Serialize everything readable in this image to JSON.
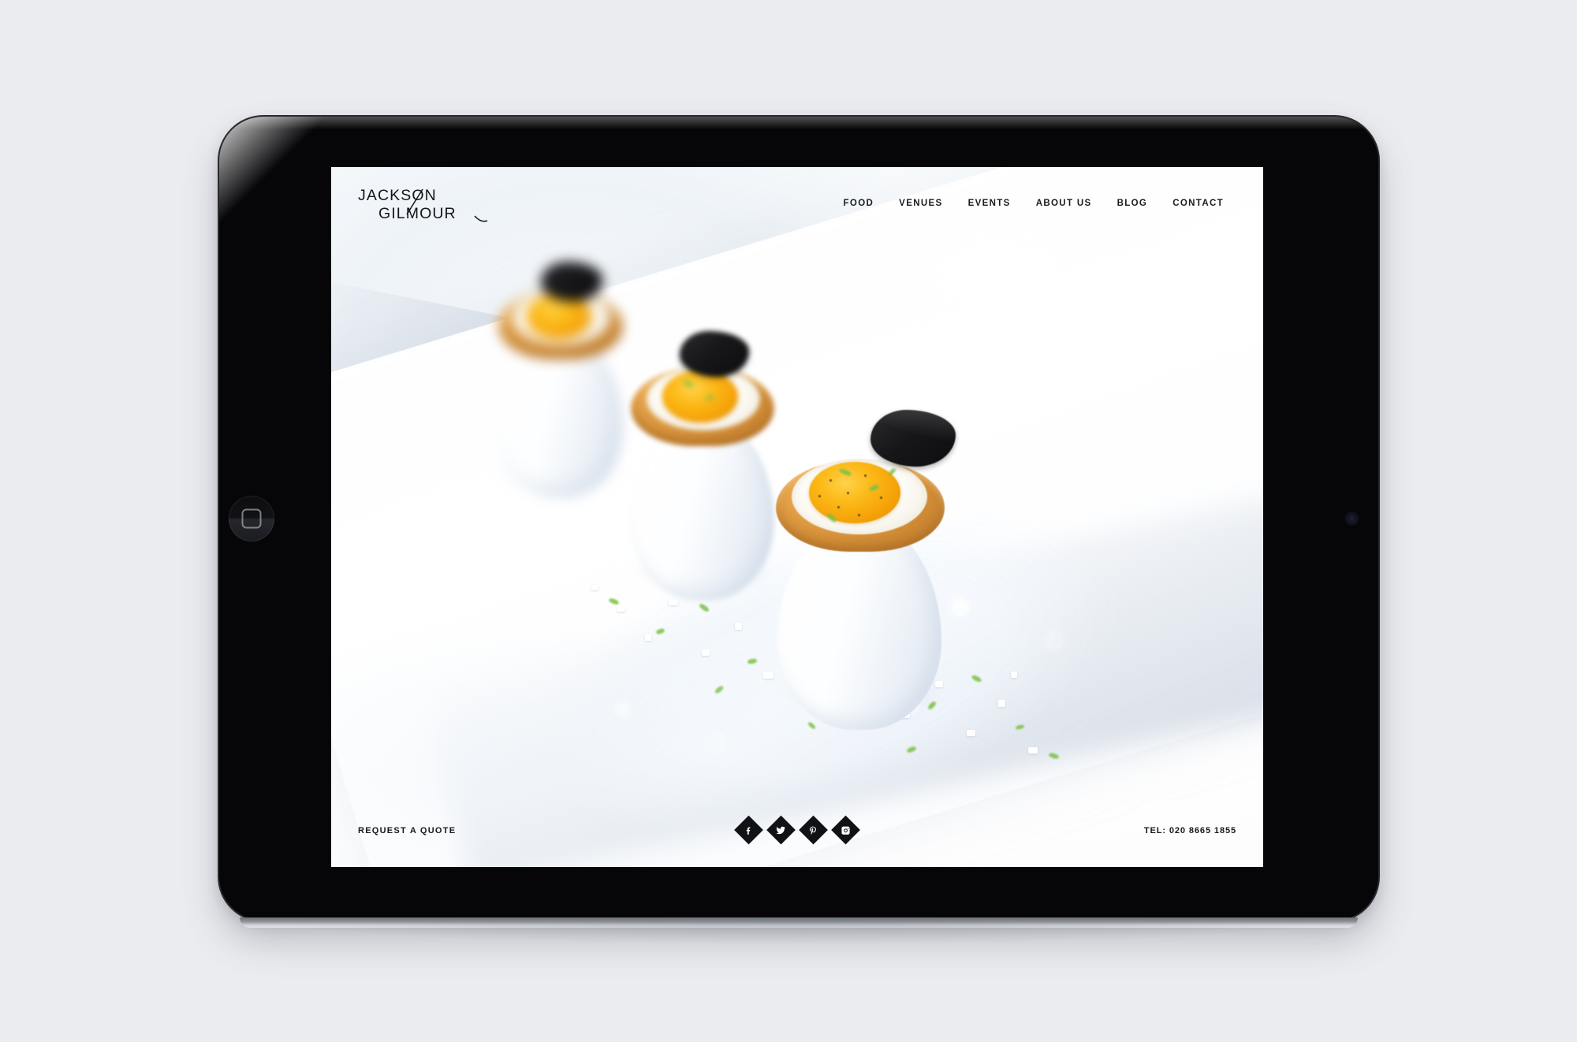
{
  "device": {
    "type": "tablet",
    "orientation": "landscape",
    "home_button": "home-button",
    "camera": "front-camera",
    "frame_color": "#060608",
    "page_background": "#ebecf0"
  },
  "site": {
    "brand": {
      "line1": "JACKSON",
      "line2": "GILMOUR",
      "logo_name": "jackson-gilmour-logo"
    },
    "nav": {
      "items": [
        {
          "label": "FOOD"
        },
        {
          "label": "VENUES"
        },
        {
          "label": "EVENTS"
        },
        {
          "label": "ABOUT US"
        },
        {
          "label": "BLOG"
        },
        {
          "label": "CONTACT"
        }
      ]
    },
    "hero": {
      "image_description": "Three baked eggs served in eggshells with crisp bacon rims, black truffle shavings and chives on a bed of rock salt in a long white dish",
      "alt": "Gourmet baked eggs in shells on rock salt"
    },
    "footer": {
      "request_quote_label": "REQUEST A QUOTE",
      "phone_label": "TEL: 020 8665 1855",
      "social": [
        {
          "name": "facebook",
          "glyph": "f"
        },
        {
          "name": "twitter",
          "glyph": "t"
        },
        {
          "name": "pinterest",
          "glyph": "p"
        },
        {
          "name": "instagram",
          "glyph": "i"
        }
      ]
    },
    "colors": {
      "text": "#16171b",
      "social_badge": "#111215",
      "yolk": "#fcb917",
      "truffle": "#171719"
    }
  }
}
